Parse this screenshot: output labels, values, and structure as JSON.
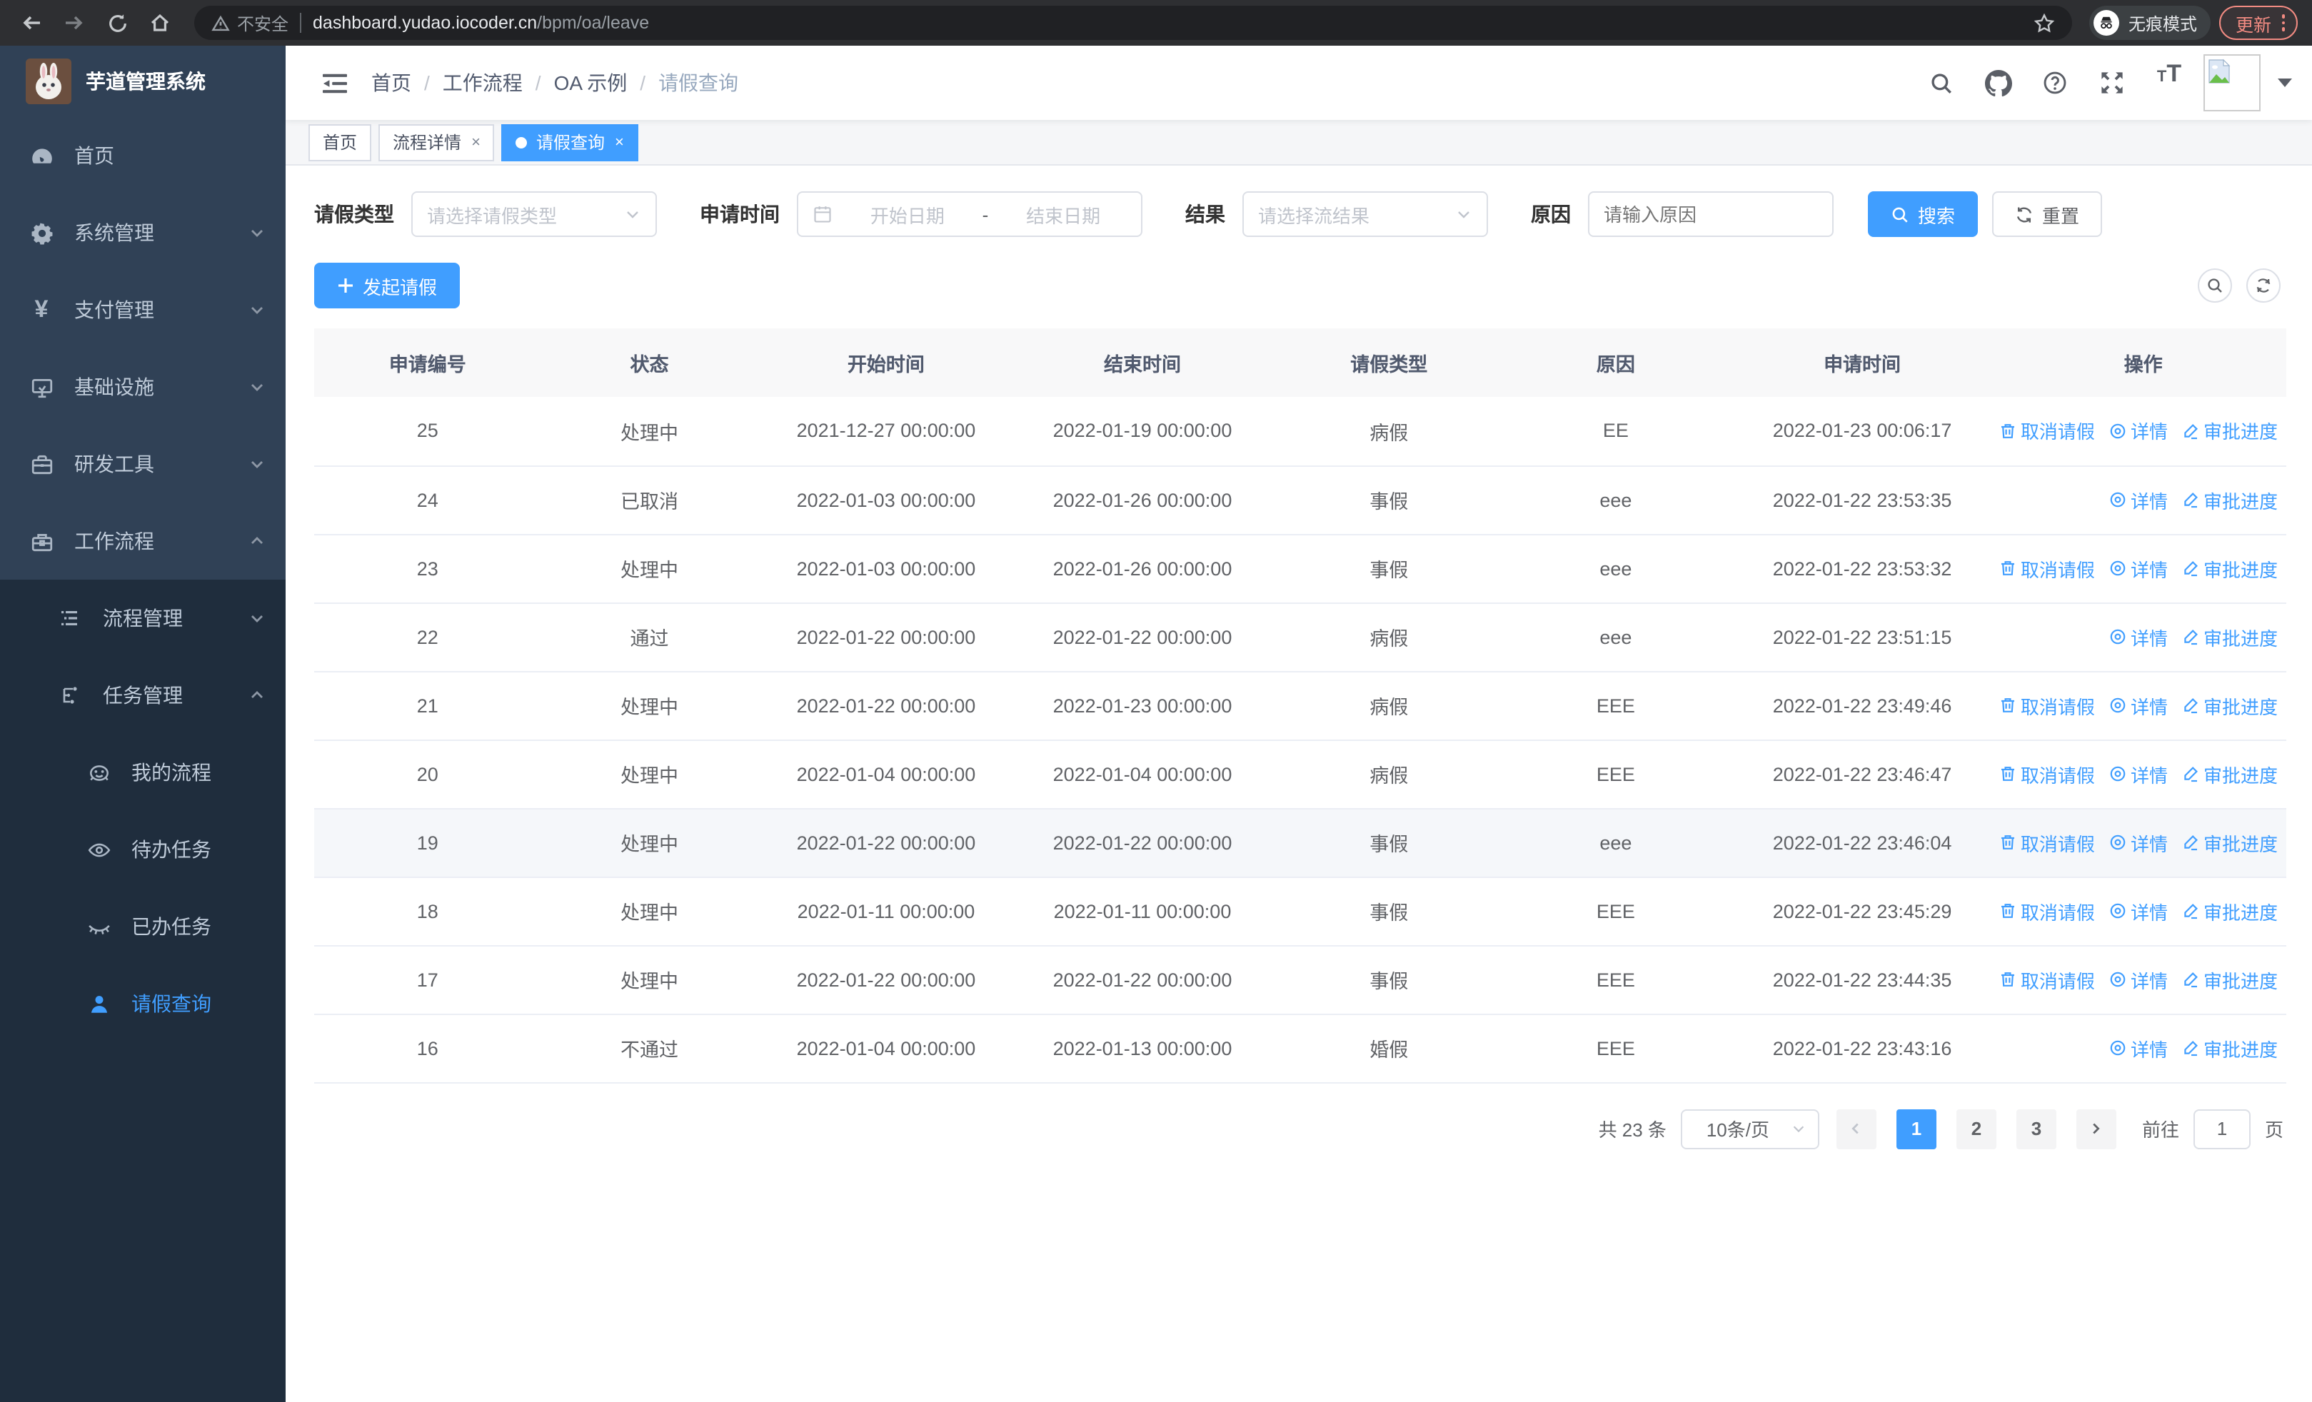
{
  "colors": {
    "accent": "#409eff",
    "sidebar_bg": "#304156",
    "submenu_bg": "#1f2d3d",
    "update_warn": "#f28b82"
  },
  "browser": {
    "security_label": "不安全",
    "url_host": "dashboard.yudao.iocoder.cn",
    "url_path": "/bpm/oa/leave",
    "incognito_label": "无痕模式",
    "update_label": "更新",
    "icons": [
      "back-icon",
      "forward-icon",
      "reload-icon",
      "home-icon",
      "warning-icon",
      "star-icon",
      "incognito-icon",
      "more-vert-icon"
    ]
  },
  "sidebar": {
    "logo_title": "芋道管理系统",
    "items": [
      {
        "label": "首页",
        "icon": "dashboard-icon"
      },
      {
        "label": "系统管理",
        "icon": "gear-icon",
        "chevron": "down"
      },
      {
        "label": "支付管理",
        "icon": "yen-icon",
        "chevron": "down"
      },
      {
        "label": "基础设施",
        "icon": "monitor-icon",
        "chevron": "down"
      },
      {
        "label": "研发工具",
        "icon": "briefcase-icon",
        "chevron": "down"
      },
      {
        "label": "工作流程",
        "icon": "toolbox-icon",
        "chevron": "up"
      },
      {
        "label": "流程管理",
        "icon": "list-tree-icon",
        "chevron": "down"
      },
      {
        "label": "任务管理",
        "icon": "workflow-icon",
        "chevron": "up"
      },
      {
        "label": "我的流程",
        "icon": "face-icon"
      },
      {
        "label": "待办任务",
        "icon": "eye-icon"
      },
      {
        "label": "已办任务",
        "icon": "eye-closed-icon"
      },
      {
        "label": "请假查询",
        "icon": "user-icon",
        "active": true
      }
    ]
  },
  "navbar": {
    "breadcrumb": [
      "首页",
      "工作流程",
      "OA 示例",
      "请假查询"
    ],
    "separator": "/",
    "icons": [
      "collapse-menu-icon",
      "search-icon",
      "github-icon",
      "help-icon",
      "fullscreen-icon",
      "font-size-icon",
      "avatar-image",
      "caret-down-icon"
    ]
  },
  "tags": [
    {
      "label": "首页",
      "closable": false,
      "active": false
    },
    {
      "label": "流程详情",
      "closable": true,
      "active": false
    },
    {
      "label": "请假查询",
      "closable": true,
      "active": true
    }
  ],
  "close_glyph": "×",
  "filters": {
    "leave_type_label": "请假类型",
    "leave_type_placeholder": "请选择请假类型",
    "apply_time_label": "申请时间",
    "start_placeholder": "开始日期",
    "range_separator": "-",
    "end_placeholder": "结束日期",
    "result_label": "结果",
    "result_placeholder": "请选择流结果",
    "reason_label": "原因",
    "reason_placeholder": "请输入原因",
    "search_label": "搜索",
    "reset_label": "重置"
  },
  "toolbar": {
    "create_label": "发起请假",
    "icons": [
      "plus-icon",
      "search-circle-icon",
      "refresh-circle-icon"
    ]
  },
  "table": {
    "headers": [
      "申请编号",
      "状态",
      "开始时间",
      "结束时间",
      "请假类型",
      "原因",
      "申请时间",
      "操作"
    ],
    "action_defs": {
      "cancel": {
        "label": "取消请假",
        "icon": "delete-icon"
      },
      "detail": {
        "label": "详情",
        "icon": "view-icon"
      },
      "progress": {
        "label": "审批进度",
        "icon": "edit-icon"
      }
    },
    "rows": [
      {
        "id": "25",
        "status": "处理中",
        "start": "2021-12-27 00:00:00",
        "end": "2022-01-19 00:00:00",
        "type": "病假",
        "reason": "EE",
        "apply": "2022-01-23 00:06:17",
        "actions": [
          "cancel",
          "detail",
          "progress"
        ]
      },
      {
        "id": "24",
        "status": "已取消",
        "start": "2022-01-03 00:00:00",
        "end": "2022-01-26 00:00:00",
        "type": "事假",
        "reason": "eee",
        "apply": "2022-01-22 23:53:35",
        "actions": [
          "detail",
          "progress"
        ]
      },
      {
        "id": "23",
        "status": "处理中",
        "start": "2022-01-03 00:00:00",
        "end": "2022-01-26 00:00:00",
        "type": "事假",
        "reason": "eee",
        "apply": "2022-01-22 23:53:32",
        "actions": [
          "cancel",
          "detail",
          "progress"
        ]
      },
      {
        "id": "22",
        "status": "通过",
        "start": "2022-01-22 00:00:00",
        "end": "2022-01-22 00:00:00",
        "type": "病假",
        "reason": "eee",
        "apply": "2022-01-22 23:51:15",
        "actions": [
          "detail",
          "progress"
        ]
      },
      {
        "id": "21",
        "status": "处理中",
        "start": "2022-01-22 00:00:00",
        "end": "2022-01-23 00:00:00",
        "type": "病假",
        "reason": "EEE",
        "apply": "2022-01-22 23:49:46",
        "actions": [
          "cancel",
          "detail",
          "progress"
        ]
      },
      {
        "id": "20",
        "status": "处理中",
        "start": "2022-01-04 00:00:00",
        "end": "2022-01-04 00:00:00",
        "type": "病假",
        "reason": "EEE",
        "apply": "2022-01-22 23:46:47",
        "actions": [
          "cancel",
          "detail",
          "progress"
        ]
      },
      {
        "id": "19",
        "status": "处理中",
        "start": "2022-01-22 00:00:00",
        "end": "2022-01-22 00:00:00",
        "type": "事假",
        "reason": "eee",
        "apply": "2022-01-22 23:46:04",
        "actions": [
          "cancel",
          "detail",
          "progress"
        ],
        "hover": true
      },
      {
        "id": "18",
        "status": "处理中",
        "start": "2022-01-11 00:00:00",
        "end": "2022-01-11 00:00:00",
        "type": "事假",
        "reason": "EEE",
        "apply": "2022-01-22 23:45:29",
        "actions": [
          "cancel",
          "detail",
          "progress"
        ]
      },
      {
        "id": "17",
        "status": "处理中",
        "start": "2022-01-22 00:00:00",
        "end": "2022-01-22 00:00:00",
        "type": "事假",
        "reason": "EEE",
        "apply": "2022-01-22 23:44:35",
        "actions": [
          "cancel",
          "detail",
          "progress"
        ]
      },
      {
        "id": "16",
        "status": "不通过",
        "start": "2022-01-04 00:00:00",
        "end": "2022-01-13 00:00:00",
        "type": "婚假",
        "reason": "EEE",
        "apply": "2022-01-22 23:43:16",
        "actions": [
          "detail",
          "progress"
        ]
      }
    ]
  },
  "pagination": {
    "total_label": "共 23 条",
    "page_size": "10条/页",
    "pages": [
      "1",
      "2",
      "3"
    ],
    "active_page": "1",
    "goto_label": "前往",
    "goto_value": "1",
    "page_suffix": "页"
  }
}
